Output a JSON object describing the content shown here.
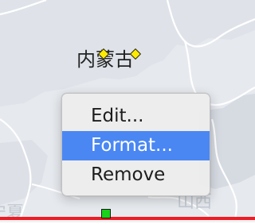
{
  "map": {
    "place_label": "内蒙古",
    "faint_labels": [
      "宁夏",
      "山西"
    ],
    "colors": {
      "land": "#e6e9ee",
      "land_dark": "#d7dce3",
      "border": "#ffffff",
      "marker_fill": "#ffeb00",
      "handle_fill": "#19d219",
      "boundary_line": "#ee1c24"
    },
    "markers": [
      "diamond-marker",
      "diamond-marker"
    ],
    "handle": "square-handle"
  },
  "context_menu": {
    "items": [
      {
        "label": "Edit...",
        "selected": false
      },
      {
        "label": "Format...",
        "selected": true
      },
      {
        "label": "Remove",
        "selected": false
      }
    ],
    "highlight_color": "#4a87f3"
  }
}
